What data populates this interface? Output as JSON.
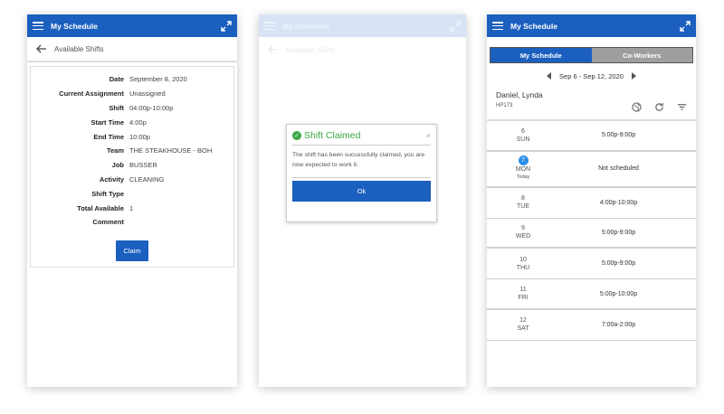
{
  "app": {
    "title": "My Schedule"
  },
  "available_shifts": {
    "header": "Available Shifts",
    "fields": [
      {
        "label": "Date",
        "value": "September 8, 2020"
      },
      {
        "label": "Current Assignment",
        "value": "Unassigned"
      },
      {
        "label": "Shift",
        "value": "04:00p-10:00p"
      },
      {
        "label": "Start Time",
        "value": "4:00p"
      },
      {
        "label": "End Time",
        "value": "10:00p"
      },
      {
        "label": "Team",
        "value": "THE STEAKHOUSE - BOH"
      },
      {
        "label": "Job",
        "value": "BUSSER"
      },
      {
        "label": "Activity",
        "value": "CLEANING"
      },
      {
        "label": "Shift Type",
        "value": ""
      },
      {
        "label": "Total Available",
        "value": "1"
      },
      {
        "label": "Comment",
        "value": ""
      }
    ],
    "claim_label": "Claim"
  },
  "dialog": {
    "title": "Shift Claimed",
    "close_label": "×",
    "message": "The shift has been successfully claimed, you are now expected to work it.",
    "ok_label": "Ok"
  },
  "schedule": {
    "tabs": [
      "My Schedule",
      "Co-Workers"
    ],
    "week_range": "Sep 6 - Sep 12, 2020",
    "employee": {
      "name": "Daniel, Lynda",
      "id": "HP173"
    },
    "days": [
      {
        "num": "6",
        "name": "SUN",
        "shift": "5:00p-9:00p"
      },
      {
        "num": "7",
        "name": "MON",
        "today_label": "Today",
        "shift": "Not scheduled"
      },
      {
        "num": "8",
        "name": "TUE",
        "shift": "4:00p-10:00p"
      },
      {
        "num": "9",
        "name": "WED",
        "shift": "5:00p-9:00p"
      },
      {
        "num": "10",
        "name": "THU",
        "shift": "5:00p-9:00p"
      },
      {
        "num": "11",
        "name": "FRI",
        "shift": "5:00p-10:00p"
      },
      {
        "num": "12",
        "name": "SAT",
        "shift": "7:00a-2:00p"
      }
    ]
  },
  "colors": {
    "primary": "#1b5fbf",
    "success": "#3aa845",
    "today": "#2c8fe6"
  }
}
